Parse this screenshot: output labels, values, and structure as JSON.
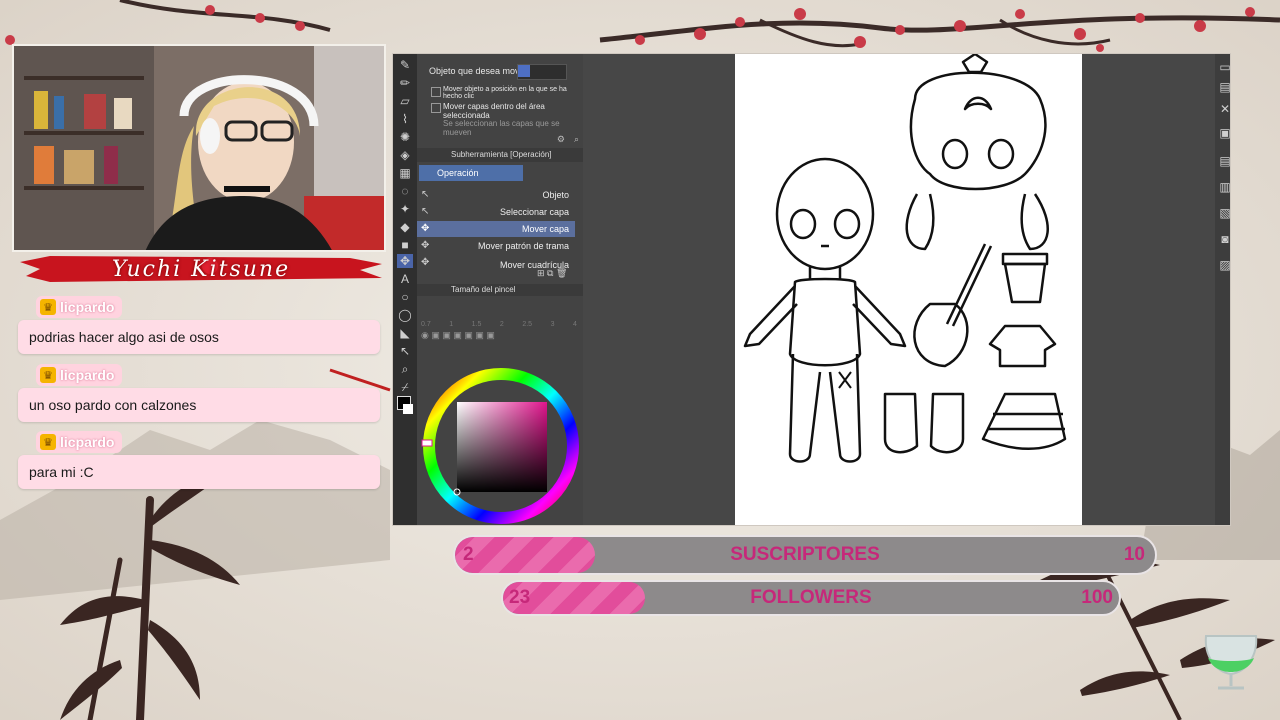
{
  "overlay": {
    "streamer_name": "Yuchi Kitsune"
  },
  "chat": {
    "messages": [
      {
        "user": "licpardo",
        "text": "podrias hacer algo asi de osos"
      },
      {
        "user": "licpardo",
        "text": "un oso pardo con calzones"
      },
      {
        "user": "licpardo",
        "text": "para mi :C"
      }
    ]
  },
  "app": {
    "tool_property": {
      "object_label": "Objeto que desea mover",
      "options": [
        "Mover objeto a posición en la que se ha hecho clic",
        "Mover capas dentro del área seleccionada"
      ],
      "hint": "Se seleccionan las capas que se mueven"
    },
    "subtool": {
      "header": "Subherramienta [Operación]",
      "group": "Operación",
      "items": [
        "Objeto",
        "Seleccionar capa",
        "Mover capa",
        "Mover patrón de trama",
        "Mover cuadrícula"
      ],
      "selected": "Mover capa"
    },
    "brush_size": {
      "header": "Tamaño del pincel",
      "values": [
        "0.7",
        "1",
        "1.5",
        "2",
        "2.5",
        "3",
        "4"
      ]
    }
  },
  "goals": {
    "subscribers": {
      "label": "SUSCRIPTORES",
      "current": "2",
      "target": "10",
      "progress": 0.2
    },
    "followers": {
      "label": "FOLLOWERS",
      "current": "23",
      "target": "100",
      "progress": 0.23
    }
  },
  "colors": {
    "accent_pink": "#e24d9b",
    "label_magenta": "#c6287a",
    "chat_bubble": "#ffdce6",
    "banner_red": "#c8141e"
  }
}
